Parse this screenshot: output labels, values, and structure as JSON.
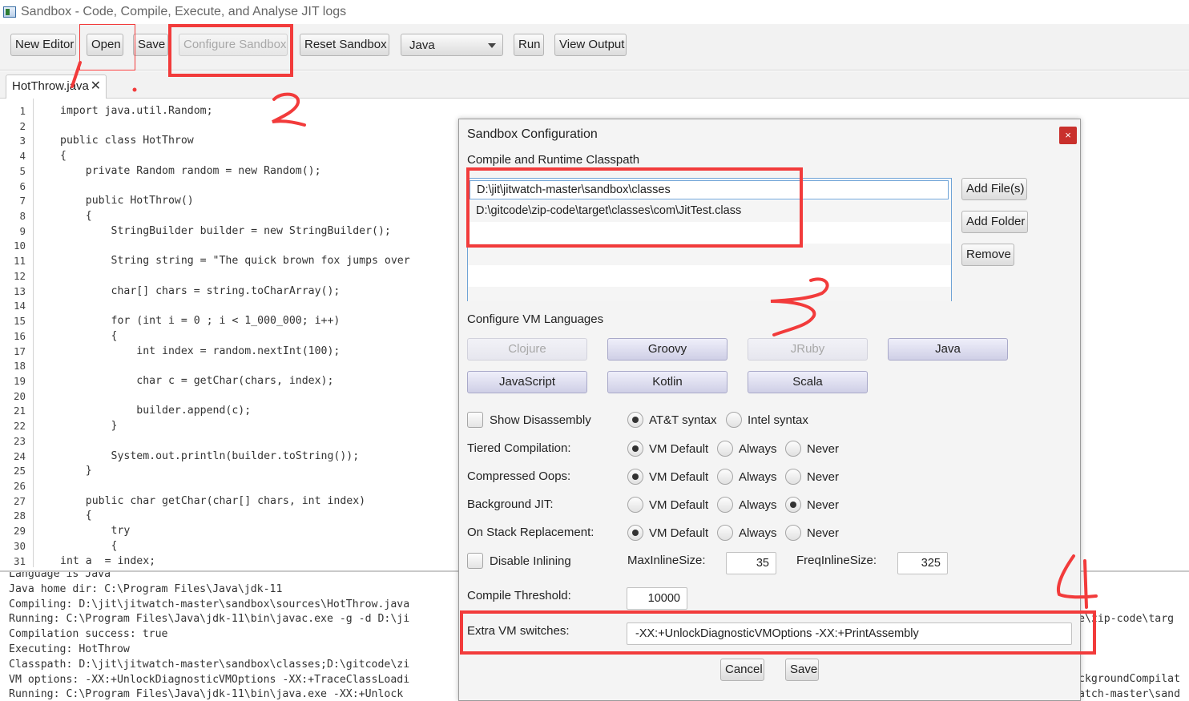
{
  "window": {
    "title": "Sandbox - Code, Compile, Execute, and Analyse JIT logs"
  },
  "toolbar": {
    "new_editor": "New Editor",
    "open": "Open",
    "save": "Save",
    "configure_sandbox": "Configure Sandbox",
    "reset_sandbox": "Reset Sandbox",
    "language": "Java",
    "run": "Run",
    "view_output": "View Output"
  },
  "tab": {
    "label": "HotThrow.java",
    "close": "✕"
  },
  "editor": {
    "line_numbers": [
      "1",
      "2",
      "3",
      "4",
      "5",
      "6",
      "7",
      "8",
      "9",
      "10",
      "11",
      "12",
      "13",
      "14",
      "15",
      "16",
      "17",
      "18",
      "19",
      "20",
      "21",
      "22",
      "23",
      "24",
      "25",
      "26",
      "27",
      "28",
      "29",
      "30",
      "31"
    ],
    "lines": [
      "import java.util.Random;",
      "",
      "public class HotThrow",
      "{",
      "    private Random random = new Random();",
      "",
      "    public HotThrow()",
      "    {",
      "        StringBuilder builder = new StringBuilder();",
      "",
      "        String string = \"The quick brown fox jumps over",
      "",
      "        char[] chars = string.toCharArray();",
      "",
      "        for (int i = 0 ; i < 1_000_000; i++)",
      "        {",
      "            int index = random.nextInt(100);",
      "",
      "            char c = getChar(chars, index);",
      "",
      "            builder.append(c);",
      "        }",
      "",
      "        System.out.println(builder.toString());",
      "    }",
      "",
      "    public char getChar(char[] chars, int index)",
      "    {",
      "        try",
      "        {",
      "int a  = index;"
    ]
  },
  "console": {
    "lines": [
      "Language is Java",
      "Java home dir: C:\\Program Files\\Java\\jdk-11",
      "Compiling: D:\\jit\\jitwatch-master\\sandbox\\sources\\HotThrow.java",
      "Running: C:\\Program Files\\Java\\jdk-11\\bin\\javac.exe -g -d D:\\ji",
      "Compilation success: true",
      "Executing: HotThrow",
      "Classpath: D:\\jit\\jitwatch-master\\sandbox\\classes;D:\\gitcode\\zi",
      "VM options: -XX:+UnlockDiagnosticVMOptions -XX:+TraceClassLoadi",
      "Running: C:\\Program Files\\Java\\jdk-11\\bin\\java.exe -XX:+Unlock"
    ],
    "right_fragments": [
      "e\\zip-code\\targ",
      "ckgroundCompilat",
      "atch-master\\sand"
    ]
  },
  "dialog": {
    "title": "Sandbox Configuration",
    "close": "×",
    "classpath_label": "Compile and Runtime Classpath",
    "classpath_items": [
      "D:\\jit\\jitwatch-master\\sandbox\\classes",
      "D:\\gitcode\\zip-code\\target\\classes\\com\\JitTest.class"
    ],
    "add_files": "Add File(s)",
    "add_folder": "Add Folder",
    "remove": "Remove",
    "vm_languages_label": "Configure VM Languages",
    "languages": {
      "clojure": "Clojure",
      "groovy": "Groovy",
      "jruby": "JRuby",
      "java": "Java",
      "javascript": "JavaScript",
      "kotlin": "Kotlin",
      "scala": "Scala"
    },
    "show_disassembly": "Show Disassembly",
    "att_syntax": "AT&T syntax",
    "intel_syntax": "Intel syntax",
    "tiered_label": "Tiered Compilation:",
    "compressed_label": "Compressed Oops:",
    "background_label": "Background JIT:",
    "osr_label": "On Stack Replacement:",
    "vm_default": "VM Default",
    "always": "Always",
    "never": "Never",
    "disable_inlining": "Disable Inlining",
    "max_inline_label": "MaxInlineSize:",
    "max_inline_value": "35",
    "freq_inline_label": "FreqInlineSize:",
    "freq_inline_value": "325",
    "compile_threshold_label": "Compile Threshold:",
    "compile_threshold_value": "10000",
    "extra_vm_label": "Extra VM switches:",
    "extra_vm_value": "-XX:+UnlockDiagnosticVMOptions -XX:+PrintAssembly",
    "cancel": "Cancel",
    "save": "Save"
  },
  "colors": {
    "annotation_red": "#f23b3b",
    "selection_blue": "#6fa3d6",
    "close_red": "#c9302c"
  }
}
